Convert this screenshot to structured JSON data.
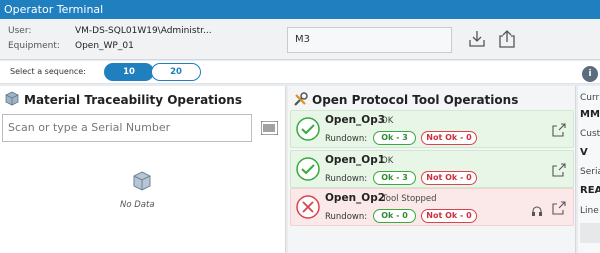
{
  "window": {
    "title": "Operator Terminal"
  },
  "info": {
    "user_label": "User:",
    "user_value": "VM-DS-SQL01W19\\Administr...",
    "equipment_label": "Equipment:",
    "equipment_value": "Open_WP_01",
    "station_value": "M3"
  },
  "sequence": {
    "label": "Select a sequence:",
    "options": [
      "10",
      "20"
    ],
    "selected": "10"
  },
  "material": {
    "title": "Material Traceability Operations",
    "search_placeholder": "Scan or type a Serial Number",
    "empty_text": "No Data"
  },
  "tools": {
    "title": "Open Protocol Tool Operations",
    "rundown_label": "Rundown:",
    "operations": [
      {
        "name": "Open_Op3",
        "state": "OK",
        "ok": "Ok - 3",
        "not_ok": "Not Ok - 0"
      },
      {
        "name": "Open_Op1",
        "state": "OK",
        "ok": "Ok - 3",
        "not_ok": "Not Ok - 0"
      },
      {
        "name": "Open_Op2",
        "state": "Tool Stopped",
        "ok": "Ok - 0",
        "not_ok": "Not Ok - 0"
      }
    ]
  },
  "details": {
    "info_icon": "i",
    "fields": [
      {
        "label": "Curr",
        "value": "MM"
      },
      {
        "label": "Cust",
        "value": "V"
      },
      {
        "label": "Seria",
        "value": "REA"
      },
      {
        "label": "Line",
        "value": ""
      }
    ]
  },
  "colors": {
    "accent": "#1f7fbf",
    "ok": "#39a83f",
    "error": "#d9434d"
  }
}
